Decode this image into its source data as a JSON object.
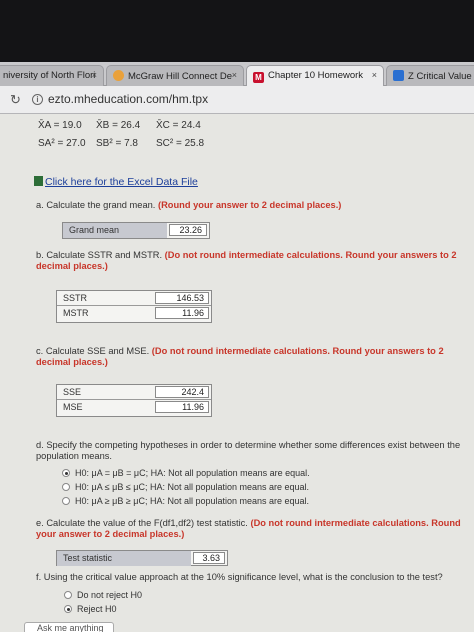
{
  "browser": {
    "tabs": [
      {
        "label": "niversity of North Flori",
        "close": "×"
      },
      {
        "label": "McGraw Hill Connect De",
        "close": "×"
      },
      {
        "label": "Chapter 10 Homework",
        "close": "×"
      },
      {
        "label": "Z Critical Value C",
        "close": ""
      }
    ],
    "reload_icon": "reload-icon",
    "url": "ezto.mheducation.com/hm.tpx"
  },
  "stats": {
    "xa": "X̄A = 19.0",
    "xb": "X̄B = 26.4",
    "xc": "X̄C = 24.4",
    "sa": "SA² = 27.0",
    "sb": "SB² = 7.8",
    "sc": "SC² = 25.8"
  },
  "excel_link": "Click here for the Excel Data File",
  "qa": {
    "prompt": "a. Calculate the grand mean.",
    "note": "(Round your answer to 2 decimal places.)",
    "label": "Grand mean",
    "value": "23.26"
  },
  "qb": {
    "prompt": "b. Calculate SSTR and MSTR.",
    "note": "(Do not round intermediate calculations. Round your answers to 2 decimal places.)",
    "rows": [
      {
        "label": "SSTR",
        "value": "146.53"
      },
      {
        "label": "MSTR",
        "value": "11.96"
      }
    ]
  },
  "qc": {
    "prompt": "c. Calculate SSE and MSE.",
    "note": "(Do not round intermediate calculations. Round your answers to 2 decimal places.)",
    "rows": [
      {
        "label": "SSE",
        "value": "242.4"
      },
      {
        "label": "MSE",
        "value": "11.96"
      }
    ]
  },
  "qd": {
    "prompt": "d. Specify the competing hypotheses in order to determine whether some differences exist between the population means.",
    "options": [
      "H0: μA = μB = μC; HA: Not all population means are equal.",
      "H0: μA ≤ μB ≤ μC; HA: Not all population means are equal.",
      "H0: μA ≥ μB ≥ μC; HA: Not all population means are equal."
    ],
    "selected": 0
  },
  "qe": {
    "prompt": "e. Calculate the value of the F(df1,df2) test statistic.",
    "note": "(Do not round intermediate calculations. Round your answer to 2 decimal places.)",
    "label": "Test statistic",
    "value": "3.63"
  },
  "qf": {
    "prompt": "f. Using the critical value approach at the 10% significance level, what is the conclusion to the test?",
    "options": [
      "Do not reject H0",
      "Reject H0"
    ],
    "selected": 1
  },
  "ask": "Ask me anything",
  "colors": {
    "accent_red": "#c8362a",
    "link_blue": "#1d3f9a",
    "mh_red": "#c8102e"
  }
}
